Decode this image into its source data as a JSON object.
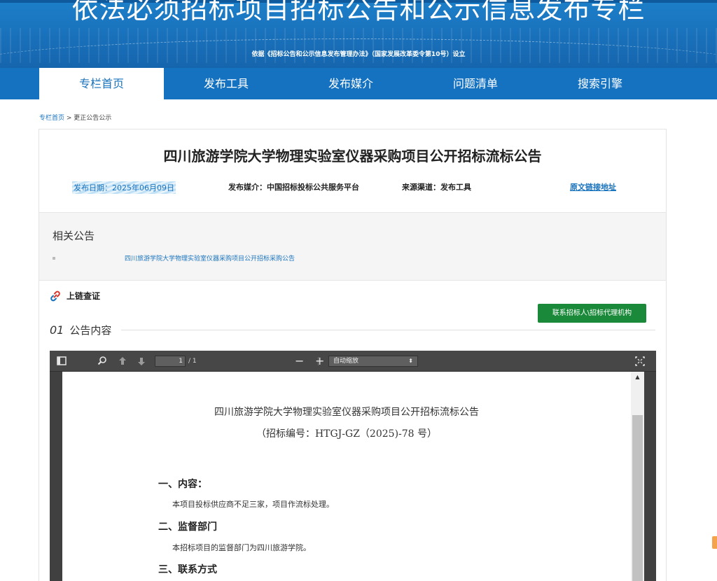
{
  "banner": {
    "title": "依法必须招标项目招标公告和公示信息发布专栏",
    "subtitle": "依据《招标公告和公示信息发布管理办法》（国家发展改革委令第10号）设立"
  },
  "nav": {
    "items": [
      {
        "label": "专栏首页",
        "active": true
      },
      {
        "label": "发布工具"
      },
      {
        "label": "发布媒介"
      },
      {
        "label": "问题清单"
      },
      {
        "label": "搜索引擎"
      }
    ]
  },
  "breadcrumb": {
    "home": "专栏首页",
    "separator": " > ",
    "current": "更正公告公示"
  },
  "notice": {
    "title": "四川旅游学院大学物理实验室仪器采购项目公开招标流标公告",
    "date": "发布日期：2025年06月09日",
    "media": "发布媒介：中国招标投标公共服务平台",
    "source": "来源渠道：发布工具",
    "original_link": "原文链接地址"
  },
  "related": {
    "heading": "相关公告",
    "items": [
      "四川旅游学院大学物理实验室仪器采购项目公开招标采购公告"
    ]
  },
  "chain": {
    "label": "上链查证"
  },
  "contact_button": "联系招标人\\招标代理机构",
  "section": {
    "number": "01",
    "label": "公告内容"
  },
  "viewer": {
    "page_current": "1",
    "page_total": "/ 1",
    "zoom": "自动缩放",
    "zoom_out": "−",
    "zoom_in": "+"
  },
  "pdf": {
    "title": "四川旅游学院大学物理实验室仪器采购项目公开招标流标公告",
    "subtitle": "（招标编号：HTGJ-GZ（2025)-78 号）",
    "sections": [
      {
        "heading": "一、内容：",
        "body": "本项目投标供应商不足三家，项目作流标处理。"
      },
      {
        "heading": "二、监督部门",
        "body": "本招标项目的监督部门为四川旅游学院。"
      },
      {
        "heading": "三、联系方式",
        "body": ""
      }
    ]
  },
  "colors": {
    "brand_blue": "#1a73bd",
    "nav_blue": "#1572c1",
    "contact_green": "#1a8a3a"
  }
}
